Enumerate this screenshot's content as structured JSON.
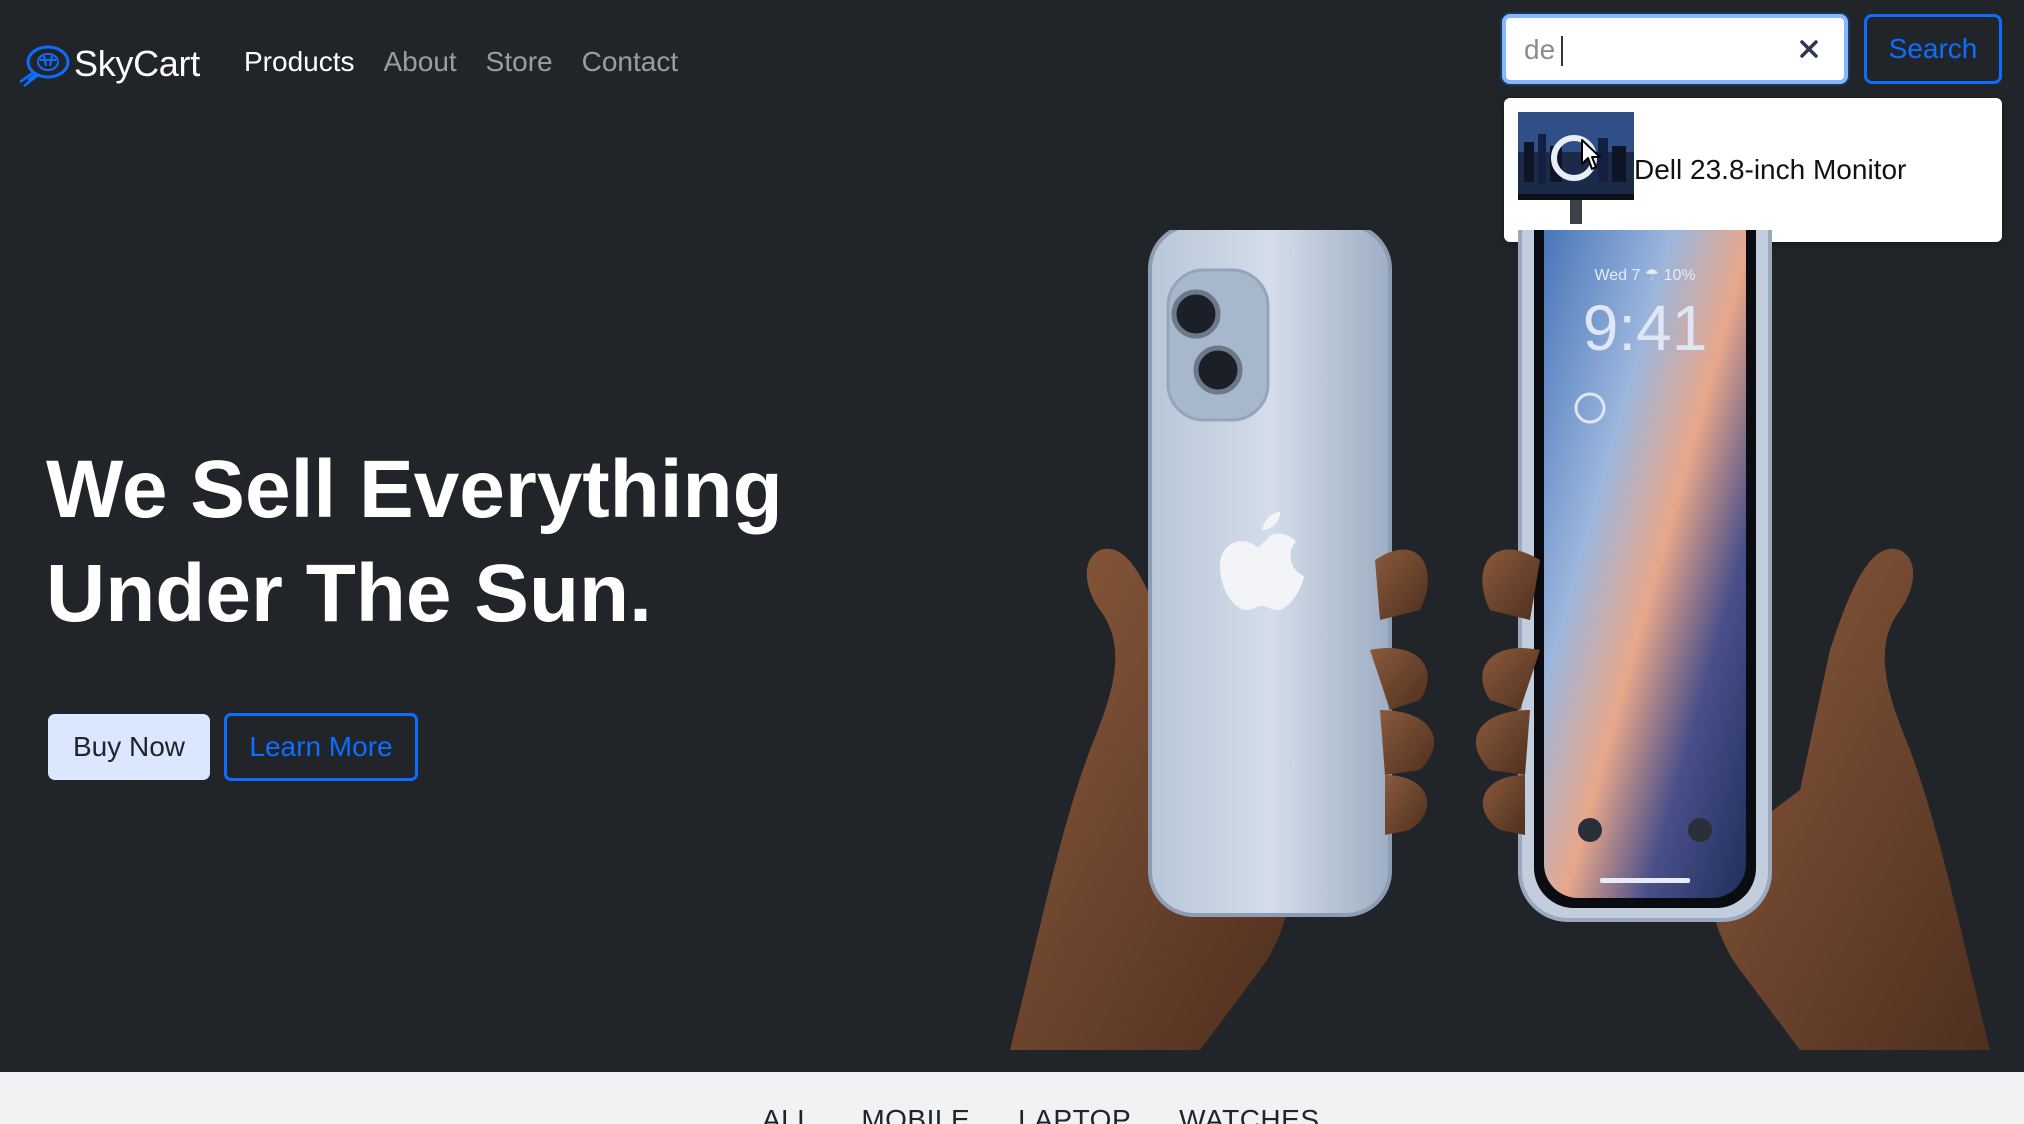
{
  "brand": {
    "name": "SkyCart",
    "logo_icon": "globe-cart-logo",
    "accent_color": "#0d6efd"
  },
  "nav": {
    "items": [
      {
        "label": "Products",
        "active": true
      },
      {
        "label": "About",
        "active": false
      },
      {
        "label": "Store",
        "active": false
      },
      {
        "label": "Contact",
        "active": false
      }
    ]
  },
  "search": {
    "value": "de",
    "clear_icon": "close-icon",
    "button_label": "Search"
  },
  "dropdown": {
    "results": [
      {
        "name": "Dell 23.8-inch Monitor",
        "thumb_icon": "monitor-thumbnail"
      }
    ]
  },
  "hero": {
    "title_line1": "We Sell Everything",
    "title_line2": "Under The Sun.",
    "buy_label": "Buy Now",
    "learn_label": "Learn More",
    "phone_time": "9:41",
    "phone_date": "Wed 7 ☂ 10%"
  },
  "categories": {
    "tabs": [
      "ALL",
      "MOBILE",
      "LAPTOP",
      "WATCHES"
    ]
  },
  "colors": {
    "background": "#212529",
    "primary": "#0d6efd",
    "buy_button_bg": "#dbe7ff"
  }
}
